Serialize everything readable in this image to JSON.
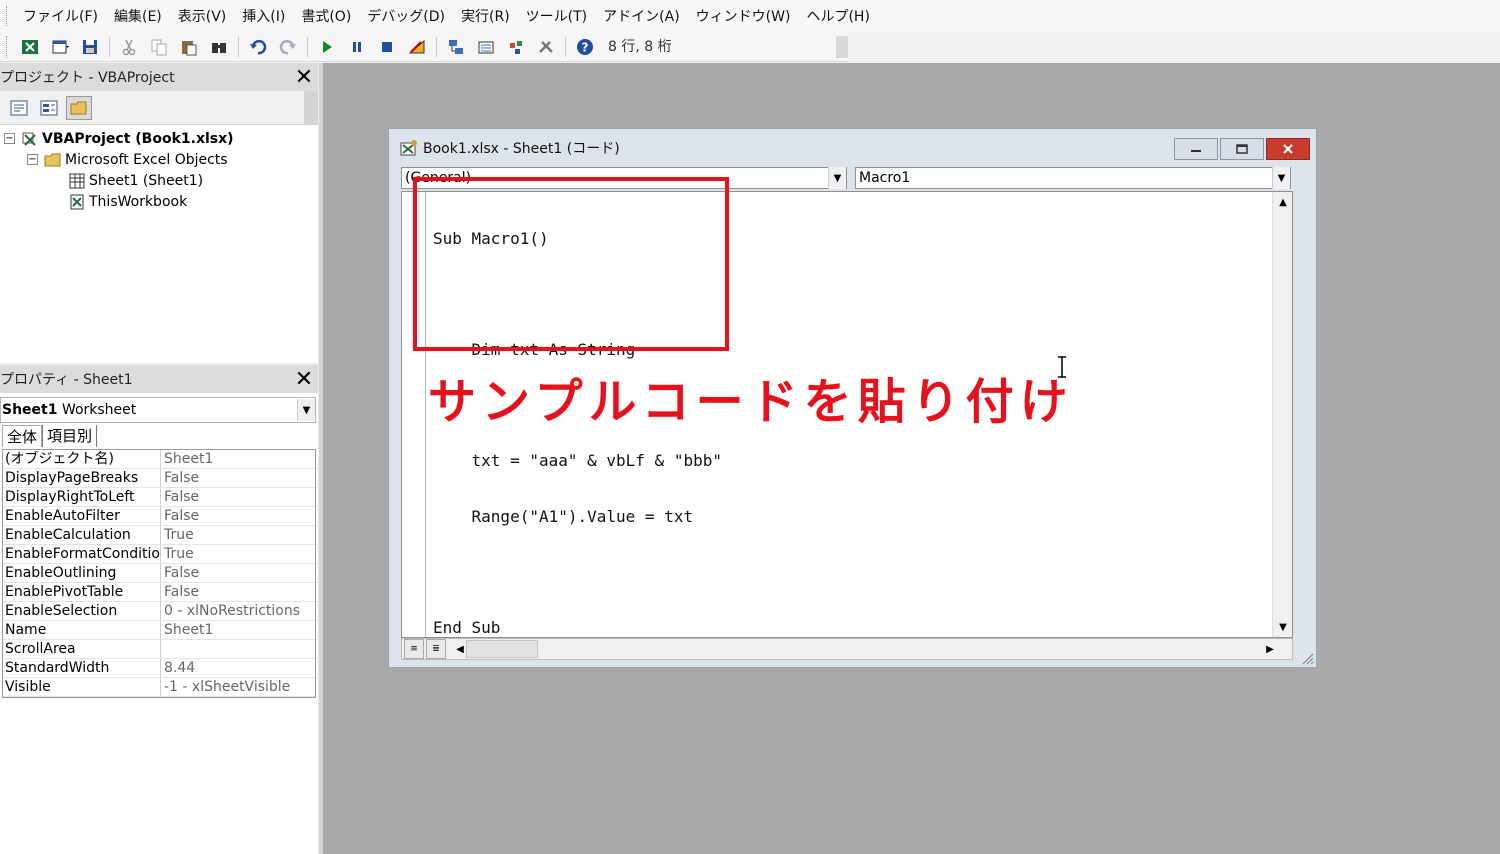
{
  "menu": {
    "items": [
      "ファイル(F)",
      "編集(E)",
      "表示(V)",
      "挿入(I)",
      "書式(O)",
      "デバッグ(D)",
      "実行(R)",
      "ツール(T)",
      "アドイン(A)",
      "ウィンドウ(W)",
      "ヘルプ(H)"
    ]
  },
  "toolbar": {
    "cursor_position": "8 行, 8 桁",
    "icons": [
      "excel-icon",
      "insert-userform-icon",
      "save-icon",
      "cut-icon",
      "copy-icon",
      "paste-icon",
      "find-icon",
      "undo-icon",
      "redo-icon",
      "run-icon",
      "break-icon",
      "reset-icon",
      "design-mode-icon",
      "project-explorer-icon",
      "properties-window-icon",
      "object-browser-icon",
      "toolbox-icon",
      "help-icon"
    ]
  },
  "project_panel": {
    "title": "プロジェクト - VBAProject",
    "tree": [
      {
        "label": "VBAProject (Book1.xlsx)",
        "level": 0,
        "toggle": "−"
      },
      {
        "label": "Microsoft Excel Objects",
        "level": 1,
        "toggle": "−"
      },
      {
        "label": "Sheet1 (Sheet1)",
        "level": 2
      },
      {
        "label": "ThisWorkbook",
        "level": 2
      }
    ]
  },
  "properties_panel": {
    "title": "プロパティ - Sheet1",
    "object_name": "Sheet1",
    "object_type": "Worksheet",
    "tabs": [
      "全体",
      "項目別"
    ],
    "rows": [
      {
        "name": "(オブジェクト名)",
        "value": "Sheet1"
      },
      {
        "name": "DisplayPageBreaks",
        "value": "False"
      },
      {
        "name": "DisplayRightToLeft",
        "value": "False"
      },
      {
        "name": "EnableAutoFilter",
        "value": "False"
      },
      {
        "name": "EnableCalculation",
        "value": "True"
      },
      {
        "name": "EnableFormatConditionsCalculation",
        "value": "True"
      },
      {
        "name": "EnableOutlining",
        "value": "False"
      },
      {
        "name": "EnablePivotTable",
        "value": "False"
      },
      {
        "name": "EnableSelection",
        "value": "0 - xlNoRestrictions"
      },
      {
        "name": "Name",
        "value": "Sheet1"
      },
      {
        "name": "ScrollArea",
        "value": ""
      },
      {
        "name": "StandardWidth",
        "value": "8.44"
      },
      {
        "name": "Visible",
        "value": "-1 - xlSheetVisible"
      }
    ]
  },
  "code_window": {
    "title": "Book1.xlsx - Sheet1 (コード)",
    "object_dropdown": "(General)",
    "procedure_dropdown": "Macro1",
    "lines": [
      "Sub Macro1()",
      "",
      "    Dim txt As String",
      "",
      "    txt = \"aaa\" & vbLf & \"bbb\"",
      "    Range(\"A1\").Value = txt",
      "",
      "End Sub"
    ]
  },
  "annotation": {
    "text": "サンプルコードを貼り付け",
    "color": "#e8101b"
  }
}
